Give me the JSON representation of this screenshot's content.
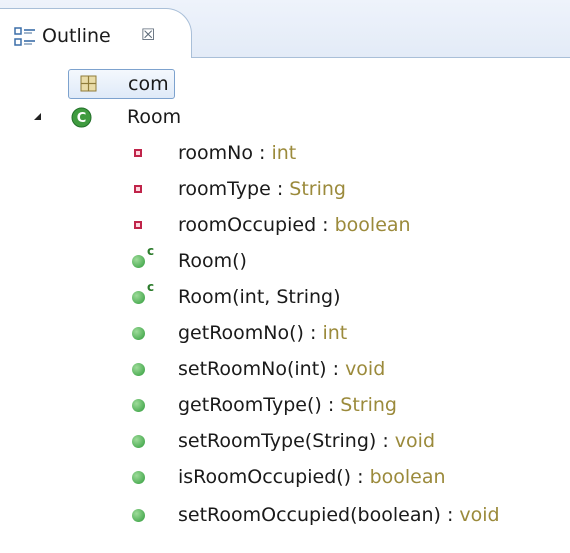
{
  "view": {
    "tab_label": "Outline",
    "close_glyph": "☒",
    "icons": {
      "tab": "outline-icon",
      "package": "package-icon",
      "class": "class-icon",
      "field": "private-field-icon",
      "method": "public-method-icon"
    },
    "colors": {
      "type_text": "#9b8a3b",
      "field_icon": "#c0244a",
      "method_icon": "#2f9b3a",
      "selection_border": "#7da2ce"
    }
  },
  "tree": {
    "package": {
      "name": "com"
    },
    "class": {
      "name": "Room",
      "expanded": true
    },
    "members": [
      {
        "name": "roomNo",
        "sep": " : ",
        "type": "int"
      },
      {
        "name": "roomType",
        "sep": " : ",
        "type": "String"
      },
      {
        "name": "roomOccupied",
        "sep": " : ",
        "type": "boolean"
      },
      {
        "name": "Room()",
        "sep": "",
        "type": "",
        "ctor_mark": "c"
      },
      {
        "name": "Room(int, String)",
        "sep": "",
        "type": "",
        "ctor_mark": "c"
      },
      {
        "name": "getRoomNo()",
        "sep": " : ",
        "type": "int"
      },
      {
        "name": "setRoomNo(int)",
        "sep": " : ",
        "type": "void"
      },
      {
        "name": "getRoomType()",
        "sep": " : ",
        "type": "String"
      },
      {
        "name": "setRoomType(String)",
        "sep": " : ",
        "type": "void"
      },
      {
        "name": "isRoomOccupied()",
        "sep": " : ",
        "type": "boolean"
      },
      {
        "name": "setRoomOccupied(boolean)",
        "sep": " : ",
        "type": "void"
      }
    ]
  }
}
